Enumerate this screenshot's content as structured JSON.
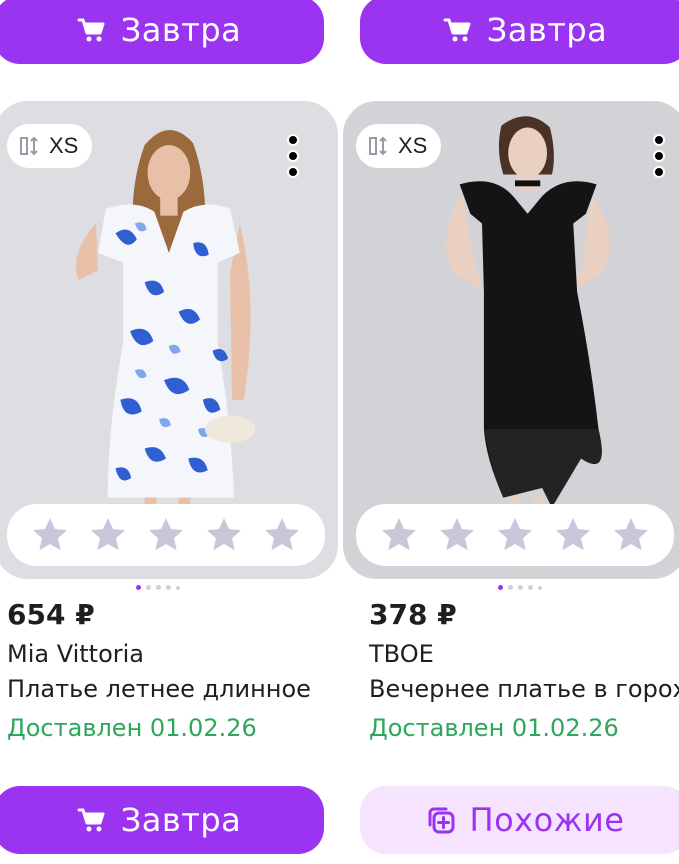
{
  "top_buttons": [
    {
      "label": "Завтра",
      "icon": "cart-icon"
    },
    {
      "label": "Завтра",
      "icon": "cart-icon"
    }
  ],
  "products": [
    {
      "size": "XS",
      "price": "654 ₽",
      "brand": "Mia Vittoria",
      "title": "Платье летнее длинное",
      "delivery": "Доставлен 01.02.26",
      "rating_stars": 0,
      "photo_colors": {
        "dress": "#2f5fd1",
        "background": "#dedde2"
      },
      "button": {
        "label": "Завтра",
        "icon": "cart-icon",
        "style": "primary"
      }
    },
    {
      "size": "XS",
      "price": "378 ₽",
      "brand": "TBOE",
      "title": "Вечернее платье в горох",
      "delivery": "Доставлен 01.02.26",
      "rating_stars": 0,
      "photo_colors": {
        "dress": "#141414",
        "background": "#d3d2d7"
      },
      "button": {
        "label": "Похожие",
        "icon": "similar-icon",
        "style": "secondary"
      }
    }
  ],
  "colors": {
    "accent": "#9b34f0",
    "accent_soft": "#f6e3fd",
    "delivery": "#2ea75b",
    "star_empty": "#c9c6da"
  }
}
